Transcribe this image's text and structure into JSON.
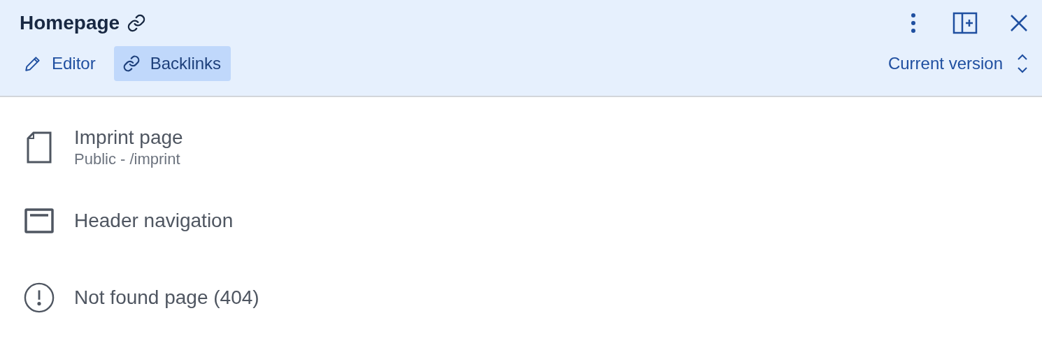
{
  "header": {
    "title": "Homepage",
    "version_select": {
      "value": "Current version"
    }
  },
  "tabs": [
    {
      "label": "Editor",
      "kind": "edit",
      "selected": false
    },
    {
      "label": "Backlinks",
      "kind": "link",
      "selected": true
    }
  ],
  "backlinks": [
    {
      "kind": "page",
      "title": "Imprint page",
      "subtitle": "Public - /imprint"
    },
    {
      "kind": "layout",
      "title": "Header navigation"
    },
    {
      "kind": "error",
      "title": "Not found page (404)"
    }
  ]
}
